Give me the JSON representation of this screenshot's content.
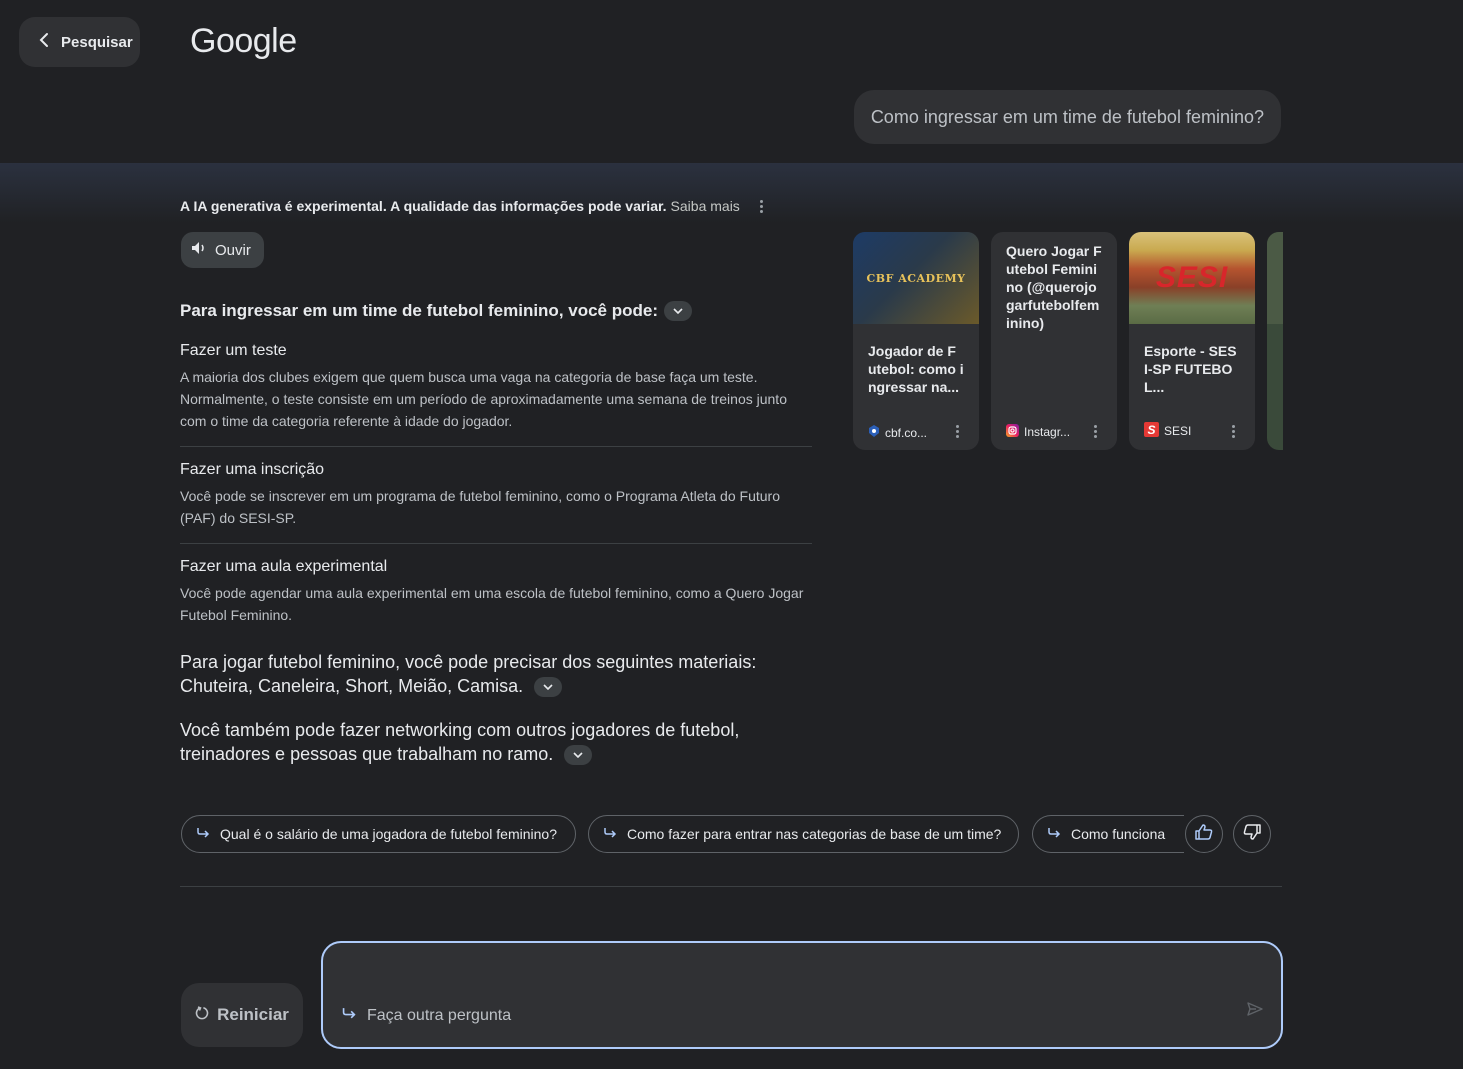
{
  "header": {
    "back_label": "Pesquisar",
    "logo": "Google"
  },
  "query": "Como ingressar em um time de futebol feminino?",
  "disclaimer": {
    "text": "A IA generativa é experimental. A qualidade das informações pode variar.",
    "link": "Saiba mais"
  },
  "listen_label": "Ouvir",
  "answer": {
    "intro": "Para ingressar em um time de futebol feminino, você pode:",
    "items": [
      {
        "title": "Fazer um teste",
        "body": "A maioria dos clubes exigem que quem busca uma vaga na categoria de base faça um teste. Normalmente, o teste consiste em um período de aproximadamente uma semana de treinos junto com o time da categoria referente à idade do jogador."
      },
      {
        "title": "Fazer uma inscrição",
        "body": "Você pode se inscrever em um programa de futebol feminino, como o Programa Atleta do Futuro (PAF) do SESI-SP."
      },
      {
        "title": "Fazer uma aula experimental",
        "body": "Você pode agendar uma aula experimental em uma escola de futebol feminino, como a Quero Jogar Futebol Feminino."
      }
    ],
    "materials": "Para jogar futebol feminino, você pode precisar dos seguintes materiais: Chuteira, Caneleira, Short, Meião, Camisa.",
    "networking": "Você também pode fazer networking com outros jogadores de futebol, treinadores e pessoas que trabalham no ramo."
  },
  "sources": [
    {
      "thumb_text": "CBF ACADEMY",
      "title": "Jogador de Futebol: como ingressar na...",
      "site": "cbf.co..."
    },
    {
      "title": "Quero Jogar Futebol Feminino (@querojogarfutebolfeminino)",
      "site": "Instagr..."
    },
    {
      "thumb_text": "SESI",
      "title": "Esporte - SESI-SP FUTEBOL...",
      "site": "SESI"
    }
  ],
  "followups": [
    "Qual é o salário de uma jogadora de futebol feminino?",
    "Como fazer para entrar nas categorias de base de um time?",
    "Como funciona"
  ],
  "reset_label": "Reiniciar",
  "ask_placeholder": "Faça outra pergunta",
  "colors": {
    "background": "#202124",
    "surface": "#303134",
    "accent_border": "#aecbfa"
  }
}
